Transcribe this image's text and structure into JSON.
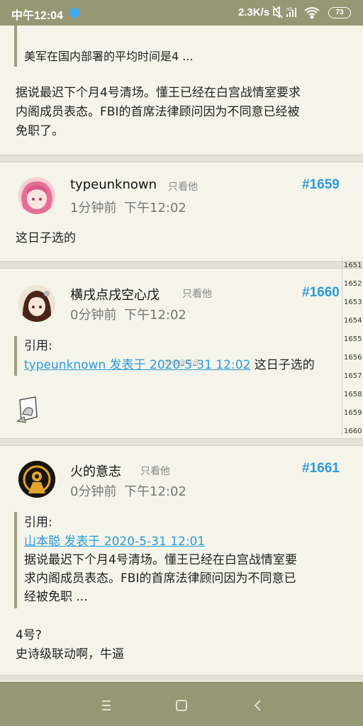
{
  "status_bar": {
    "time": "中午12:04",
    "net_speed": "2.3K/s",
    "battery": "73",
    "icons": [
      "app-notification-icon",
      "mute-icon",
      "hd-signal-icon",
      "signal-icon",
      "wifi-icon",
      "battery-icon"
    ]
  },
  "post_top": {
    "quote_text": "美军在国内部署的平均时间是4 ...",
    "body_lines": [
      "据说最迟下个月4号清场。懂王已经在白宫战情室要求",
      "内阁成员表态。FBI的首席法律顾问因为不同意已经被",
      "免职了。"
    ]
  },
  "posts": [
    {
      "username": "typeunknown",
      "only_him": "只看他",
      "floor": "#1659",
      "relative_time": "1分钟前",
      "time": "下午12:02",
      "body": "这日子选的"
    },
    {
      "username": "横戌点戌空心戊",
      "only_him": "只看他",
      "floor": "#1660",
      "relative_time": "0分钟前",
      "time": "下午12:02",
      "quote_label": "引用:",
      "quote_link": "typeunknown 发表于 2020-5-31 12:02",
      "quote_text": " 这日子选的",
      "watermark": "@@@@@",
      "sticker": "image-sticker"
    },
    {
      "username": "火的意志",
      "only_him": "只看他",
      "floor": "#1661",
      "relative_time": "0分钟前",
      "time": "下午12:02",
      "quote_label": "引用:",
      "quote_link": "山本聪 发表于 2020-5-31 12:01",
      "quote_lines": [
        "据说最迟下个月4号清场。懂王已经在白宫战情室要",
        "求内阁成员表态。FBI的首席法律顾问因为不同意已",
        "经被免职 ..."
      ],
      "body_lines": [
        "4号?",
        "史诗级联动啊，牛逼"
      ]
    }
  ],
  "floor_scrubber": [
    "1651",
    "1652",
    "1653",
    "1654",
    "1655",
    "1656",
    "1657",
    "1658",
    "1659",
    "1660"
  ],
  "nav_bar": {
    "buttons": [
      "menu-icon",
      "home-icon",
      "back-icon"
    ]
  },
  "colors": {
    "bars": "#959874",
    "background": "#f4f4ea",
    "accent": "#2c9ad8"
  }
}
